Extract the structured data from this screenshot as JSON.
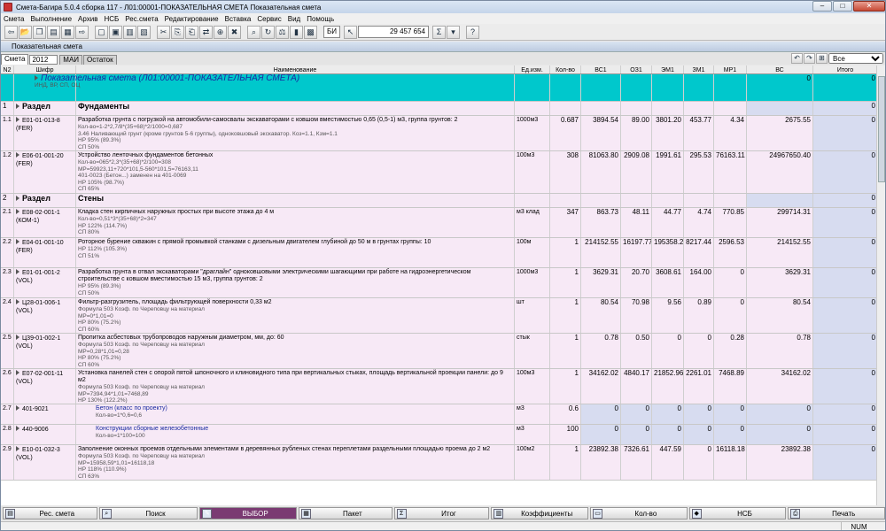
{
  "window": {
    "title": "Смета-Багира 5.0.4 сборка 117   -   Л01:00001-ПОКАЗАТЕЛЬНАЯ СМЕТА Показательная смета"
  },
  "menu": [
    "Смета",
    "Выполнение",
    "Архив",
    "НСБ",
    "Рес.смета",
    "Редактирование",
    "Вставка",
    "Сервис",
    "Вид",
    "Помощь"
  ],
  "toolbar": {
    "bi_label": "БИ",
    "total_value": "29 457 654",
    "sigma": "Σ",
    "help": "?"
  },
  "panel": {
    "title": "Показательная смета"
  },
  "tabs": {
    "active": "Смета",
    "year": "2012",
    "tab_mai": "МАИ",
    "tab_ostatok": "Остаток",
    "filter_value": "Все"
  },
  "columns": [
    "N2",
    "Шифр",
    "Наименование",
    "Ед.изм.",
    "Кол-во",
    "ВС1",
    "ОЗ1",
    "ЭМ1",
    "ЗМ1",
    "МР1",
    "ВС",
    "Итого"
  ],
  "title_row": {
    "name": "Показательная смета (Л01:00001-ПОКАЗАТЕЛЬНАЯ СМЕТА)",
    "sub": "ИНД, ВР, СП, ОЦ",
    "vs": "0",
    "itogo": "0"
  },
  "rows": [
    {
      "type": "section",
      "n": "1",
      "label": "Раздел",
      "name": "Фундаменты",
      "vs": "",
      "itogo": "0"
    },
    {
      "type": "item",
      "n": "1.1",
      "code": "Е01-01-013-8 (FER)",
      "name": "Разработка грунта с погрузкой на автомобили-самосвалы экскаваторами с ковшом вместимостью 0,65 (0,5-1) м3, группа грунтов: 2",
      "sub": [
        "Кол-во=1-2*2,7/8*(35+68)*2/1000=0,687",
        "3.46 Наливающий грунт (кроме грунтов 5-6 группы), одноковшовый экскаватор. Коз=1.1, Кзм=1.1",
        "НР 95% (89.3%)",
        "СП 50%"
      ],
      "unit": "1000м3",
      "qty": "0.687",
      "vs1": "3894.54",
      "oz1": "89.00",
      "em1": "3801.20",
      "zm1": "453.77",
      "mr1": "4.34",
      "vs": "2675.55",
      "itogo": "0"
    },
    {
      "type": "item",
      "n": "1.2",
      "code": "Е06-01-001-20 (FER)",
      "name": "Устройство ленточных фундаментов бетонных",
      "sub": [
        "Кол-во=065*2,3*(35+68)*2/100=308",
        "МР=59923,11+720*101,5-560*101,5=76163,11",
        "401-0023 (Бетон...) заменен на 401-0069",
        "НР 105% (98.7%)",
        "СП 65%"
      ],
      "unit": "100м3",
      "qty": "308",
      "vs1": "81063.80",
      "oz1": "2909.08",
      "em1": "1991.61",
      "zm1": "295.53",
      "mr1": "76163.11",
      "vs": "24967650.40",
      "itogo": "0"
    },
    {
      "type": "section",
      "n": "2",
      "label": "Раздел",
      "name": "Стены",
      "vs": "",
      "itogo": "0"
    },
    {
      "type": "item",
      "n": "2.1",
      "code": "Е08-02-001-1 (КОМ-1)",
      "name": "Кладка стен кирпичных наружных простых при высоте этажа до 4 м",
      "sub": [
        "Кол-во=0,51*3*(35+68)*2=347",
        "НР 122% (114.7%)",
        "СП 80%"
      ],
      "unit": "м3 клад",
      "qty": "347",
      "vs1": "863.73",
      "oz1": "48.11",
      "em1": "44.77",
      "zm1": "4.74",
      "mr1": "770.85",
      "vs": "299714.31",
      "itogo": "0"
    },
    {
      "type": "item",
      "n": "2.2",
      "code": "Е04-01-001-10 (FER)",
      "name": "Роторное бурение скважин с прямой промывкой станками с дизельным двигателем глубиной до 50 м в грунтах группы: 10",
      "sub": [
        "НР 112% (105.3%)",
        "СП 51%"
      ],
      "unit": "100м",
      "qty": "1",
      "vs1": "214152.55",
      "oz1": "16197.77",
      "em1": "195358.25",
      "zm1": "8217.44",
      "mr1": "2596.53",
      "vs": "214152.55",
      "itogo": "0"
    },
    {
      "type": "item",
      "n": "2.3",
      "code": "Е01-01-001-2 (VOL)",
      "name": "Разработка грунта в отвал экскаваторами \"драглайн\" одноковшовыми электрическими шагающими при работе на гидроэнергетическом строительстве с ковшом вместимостью 15 м3, группа грунтов: 2",
      "sub": [
        "НР 95% (89.3%)",
        "СП 50%"
      ],
      "unit": "1000м3",
      "qty": "1",
      "vs1": "3629.31",
      "oz1": "20.70",
      "em1": "3608.61",
      "zm1": "164.00",
      "mr1": "0",
      "vs": "3629.31",
      "itogo": "0"
    },
    {
      "type": "item",
      "n": "2.4",
      "code": "Ц28-01-006-1 (VOL)",
      "name": "Фильтр-разгрузитель, площадь фильтрующей поверхности 0,33 м2",
      "sub": [
        "Формула 503    Коэф. по Череповцу на материал",
        "МР=0*1,01=0",
        "НР 80% (75.2%)",
        "СП 60%"
      ],
      "unit": "шт",
      "qty": "1",
      "vs1": "80.54",
      "oz1": "70.98",
      "em1": "9.56",
      "zm1": "0.89",
      "mr1": "0",
      "vs": "80.54",
      "itogo": "0"
    },
    {
      "type": "item",
      "n": "2.5",
      "code": "Ц39-01-002-1 (VOL)",
      "name": "Пропитка асбестовых трубопроводов наружным диаметром, мм, до: 60",
      "sub": [
        "Формула 503    Коэф. по Череповцу на материал",
        "МР=0,28*1,01=0,28",
        "НР 80% (75.2%)",
        "СП 60%"
      ],
      "unit": "стык",
      "qty": "1",
      "vs1": "0.78",
      "oz1": "0.50",
      "em1": "0",
      "zm1": "0",
      "mr1": "0.28",
      "vs": "0.78",
      "itogo": "0"
    },
    {
      "type": "item",
      "n": "2.6",
      "code": "Е07-02-001-11 (VOL)",
      "name": "Установка панелей стен с опорой пятой шпоночного и клиновидного типа при вертикальных стыках, площадь вертикальной проекции панели: до 9 м2",
      "sub": [
        "Формула 503    Коэф. по Череповцу на материал",
        "МР=7394,94*1,01=7468,89",
        "НР 130% (122.2%)",
        "СП 65%"
      ],
      "unit": "100м3",
      "qty": "1",
      "vs1": "34162.02",
      "oz1": "4840.17",
      "em1": "21852.96",
      "zm1": "2261.01",
      "mr1": "7468.89",
      "vs": "34162.02",
      "itogo": "0"
    },
    {
      "type": "res",
      "n": "2.7",
      "code": "401-9021",
      "name": "Бетон (класс по проекту)",
      "sub": [
        "Кол-во=1*0,6=0,6"
      ],
      "unit": "м3",
      "qty": "0.6",
      "vs1": "0",
      "oz1": "0",
      "em1": "0",
      "zm1": "0",
      "mr1": "0",
      "vs": "0",
      "itogo": "0"
    },
    {
      "type": "res",
      "n": "2.8",
      "code": "440-9006",
      "name": "Конструкции сборные железобетонные",
      "sub": [
        "Кол-во=1*100=100"
      ],
      "unit": "м3",
      "qty": "100",
      "vs1": "0",
      "oz1": "0",
      "em1": "0",
      "zm1": "0",
      "mr1": "0",
      "vs": "0",
      "itogo": "0"
    },
    {
      "type": "item",
      "n": "2.9",
      "code": "Е10-01-032-3 (VOL)",
      "name": "Заполнение оконных проемов отдельными элементами в деревянных рубленых стенах переплетами раздельными площадью проема до 2 м2",
      "sub": [
        "Формула 503    Коэф. по Череповцу на материал",
        "МР=15958,59*1,01=16118,18",
        "НР 118% (110.9%)",
        "СП 63%"
      ],
      "unit": "100м2",
      "qty": "1",
      "vs1": "23892.38",
      "oz1": "7326.61",
      "em1": "447.59",
      "zm1": "0",
      "mr1": "16118.18",
      "vs": "23892.38",
      "itogo": "0"
    }
  ],
  "bottom_buttons": [
    "Рес. смета",
    "Поиск",
    "ВЫБОР",
    "Пакет",
    "Итог",
    "Коэффициенты",
    "Кол-во",
    "НСБ",
    "Печать"
  ],
  "status": {
    "numlock": "NUM"
  }
}
